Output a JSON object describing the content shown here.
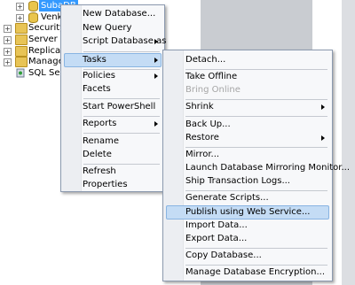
{
  "tree": {
    "nodes": [
      {
        "label": "SubaDB",
        "selected": true
      },
      {
        "label": "Venkat",
        "selected": false
      },
      {
        "label": "Security"
      },
      {
        "label": "Server Obj"
      },
      {
        "label": "Replication"
      },
      {
        "label": "Managem"
      },
      {
        "label": "SQL Serve"
      }
    ]
  },
  "context_menu": {
    "items": [
      {
        "label": "New Database..."
      },
      {
        "label": "New Query"
      },
      {
        "label": "Script Database as"
      },
      {
        "label": "Tasks"
      },
      {
        "label": "Policies"
      },
      {
        "label": "Facets"
      },
      {
        "label": "Start PowerShell"
      },
      {
        "label": "Reports"
      },
      {
        "label": "Rename"
      },
      {
        "label": "Delete"
      },
      {
        "label": "Refresh"
      },
      {
        "label": "Properties"
      }
    ]
  },
  "tasks_submenu": {
    "items": [
      {
        "label": "Detach..."
      },
      {
        "label": "Take Offline"
      },
      {
        "label": "Bring Online",
        "disabled": true
      },
      {
        "label": "Shrink"
      },
      {
        "label": "Back Up..."
      },
      {
        "label": "Restore"
      },
      {
        "label": "Mirror..."
      },
      {
        "label": "Launch Database Mirroring Monitor..."
      },
      {
        "label": "Ship Transaction Logs..."
      },
      {
        "label": "Generate Scripts..."
      },
      {
        "label": "Publish using Web Service..."
      },
      {
        "label": "Import Data..."
      },
      {
        "label": "Export Data..."
      },
      {
        "label": "Copy Database..."
      },
      {
        "label": "Manage Database Encryption..."
      }
    ]
  },
  "colors": {
    "selection": "#3399ff",
    "menu_hover": "#c4dcf5",
    "menu_hover_border": "#88b4e2",
    "folder": "#e8c456"
  }
}
